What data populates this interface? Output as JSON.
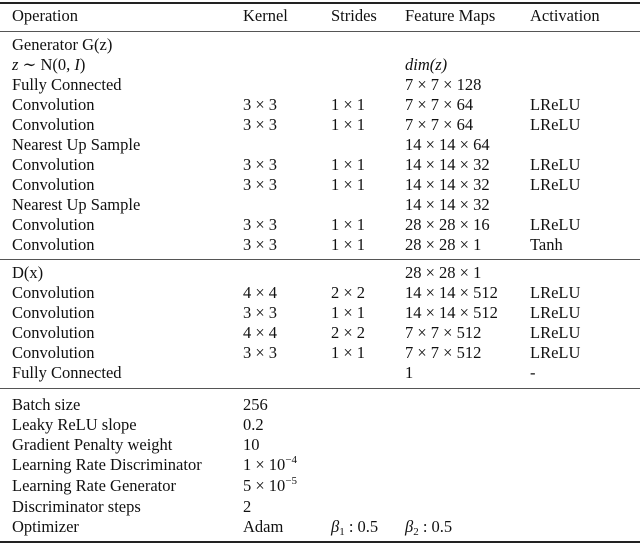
{
  "header": [
    "Operation",
    "Kernel",
    "Strides",
    "Feature Maps",
    "Activation"
  ],
  "generator": {
    "rows": [
      {
        "op": "Generator G(z)",
        "kernel": "",
        "strides": "",
        "fmaps": "",
        "act": ""
      },
      {
        "op": "z ∼ N(0, I)",
        "kernel": "",
        "strides": "",
        "fmaps": "dim(z)",
        "act": ""
      },
      {
        "op": "Fully Connected",
        "kernel": "",
        "strides": "",
        "fmaps": "7 × 7 × 128",
        "act": ""
      },
      {
        "op": "Convolution",
        "kernel": "3 × 3",
        "strides": "1 × 1",
        "fmaps": "7 × 7 × 64",
        "act": "LReLU"
      },
      {
        "op": "Convolution",
        "kernel": "3 × 3",
        "strides": "1 × 1",
        "fmaps": "7 × 7 × 64",
        "act": "LReLU"
      },
      {
        "op": "Nearest Up Sample",
        "kernel": "",
        "strides": "",
        "fmaps": "14 × 14 × 64",
        "act": ""
      },
      {
        "op": "Convolution",
        "kernel": "3 × 3",
        "strides": "1 × 1",
        "fmaps": "14 × 14 × 32",
        "act": "LReLU"
      },
      {
        "op": "Convolution",
        "kernel": "3 × 3",
        "strides": "1 × 1",
        "fmaps": "14 × 14 × 32",
        "act": "LReLU"
      },
      {
        "op": "Nearest Up Sample",
        "kernel": "",
        "strides": "",
        "fmaps": "14 × 14 × 32",
        "act": ""
      },
      {
        "op": "Convolution",
        "kernel": "3 × 3",
        "strides": "1 × 1",
        "fmaps": "28 × 28 × 16",
        "act": "LReLU"
      },
      {
        "op": "Convolution",
        "kernel": "3 × 3",
        "strides": "1 × 1",
        "fmaps": "28 × 28 × 1",
        "act": "Tanh"
      }
    ]
  },
  "discriminator": {
    "rows": [
      {
        "op": "D(x)",
        "kernel": "",
        "strides": "",
        "fmaps": "28 × 28 × 1",
        "act": ""
      },
      {
        "op": "Convolution",
        "kernel": "4 × 4",
        "strides": "2 × 2",
        "fmaps": "14 × 14 × 512",
        "act": "LReLU"
      },
      {
        "op": "Convolution",
        "kernel": "3 × 3",
        "strides": "1 × 1",
        "fmaps": "14 × 14 × 512",
        "act": "LReLU"
      },
      {
        "op": "Convolution",
        "kernel": "4 × 4",
        "strides": "2 × 2",
        "fmaps": "7 × 7 × 512",
        "act": "LReLU"
      },
      {
        "op": "Convolution",
        "kernel": "3 × 3",
        "strides": "1 × 1",
        "fmaps": "7 × 7 × 512",
        "act": "LReLU"
      },
      {
        "op": "Fully Connected",
        "kernel": "",
        "strides": "",
        "fmaps": "1",
        "act": "-"
      }
    ]
  },
  "hyperparams": {
    "rows": [
      {
        "name": "Batch size",
        "value": "256",
        "extra1": "",
        "extra2": ""
      },
      {
        "name": "Leaky ReLU slope",
        "value": "0.2",
        "extra1": "",
        "extra2": ""
      },
      {
        "name": "Gradient Penalty weight",
        "value": "10",
        "extra1": "",
        "extra2": ""
      },
      {
        "name": "Learning Rate Discriminator",
        "value_base": "1 × 10",
        "value_exp": "−4",
        "extra1": "",
        "extra2": ""
      },
      {
        "name": "Learning Rate Generator",
        "value_base": "5 × 10",
        "value_exp": "−5",
        "extra1": "",
        "extra2": ""
      },
      {
        "name": "Discriminator steps",
        "value": "2",
        "extra1": "",
        "extra2": ""
      },
      {
        "name": "Optimizer",
        "value": "Adam",
        "beta1_sym": "β",
        "beta1_sub": "1",
        "beta1_val": " : 0.5",
        "beta2_sym": "β",
        "beta2_sub": "2",
        "beta2_val": " : 0.5"
      }
    ]
  }
}
